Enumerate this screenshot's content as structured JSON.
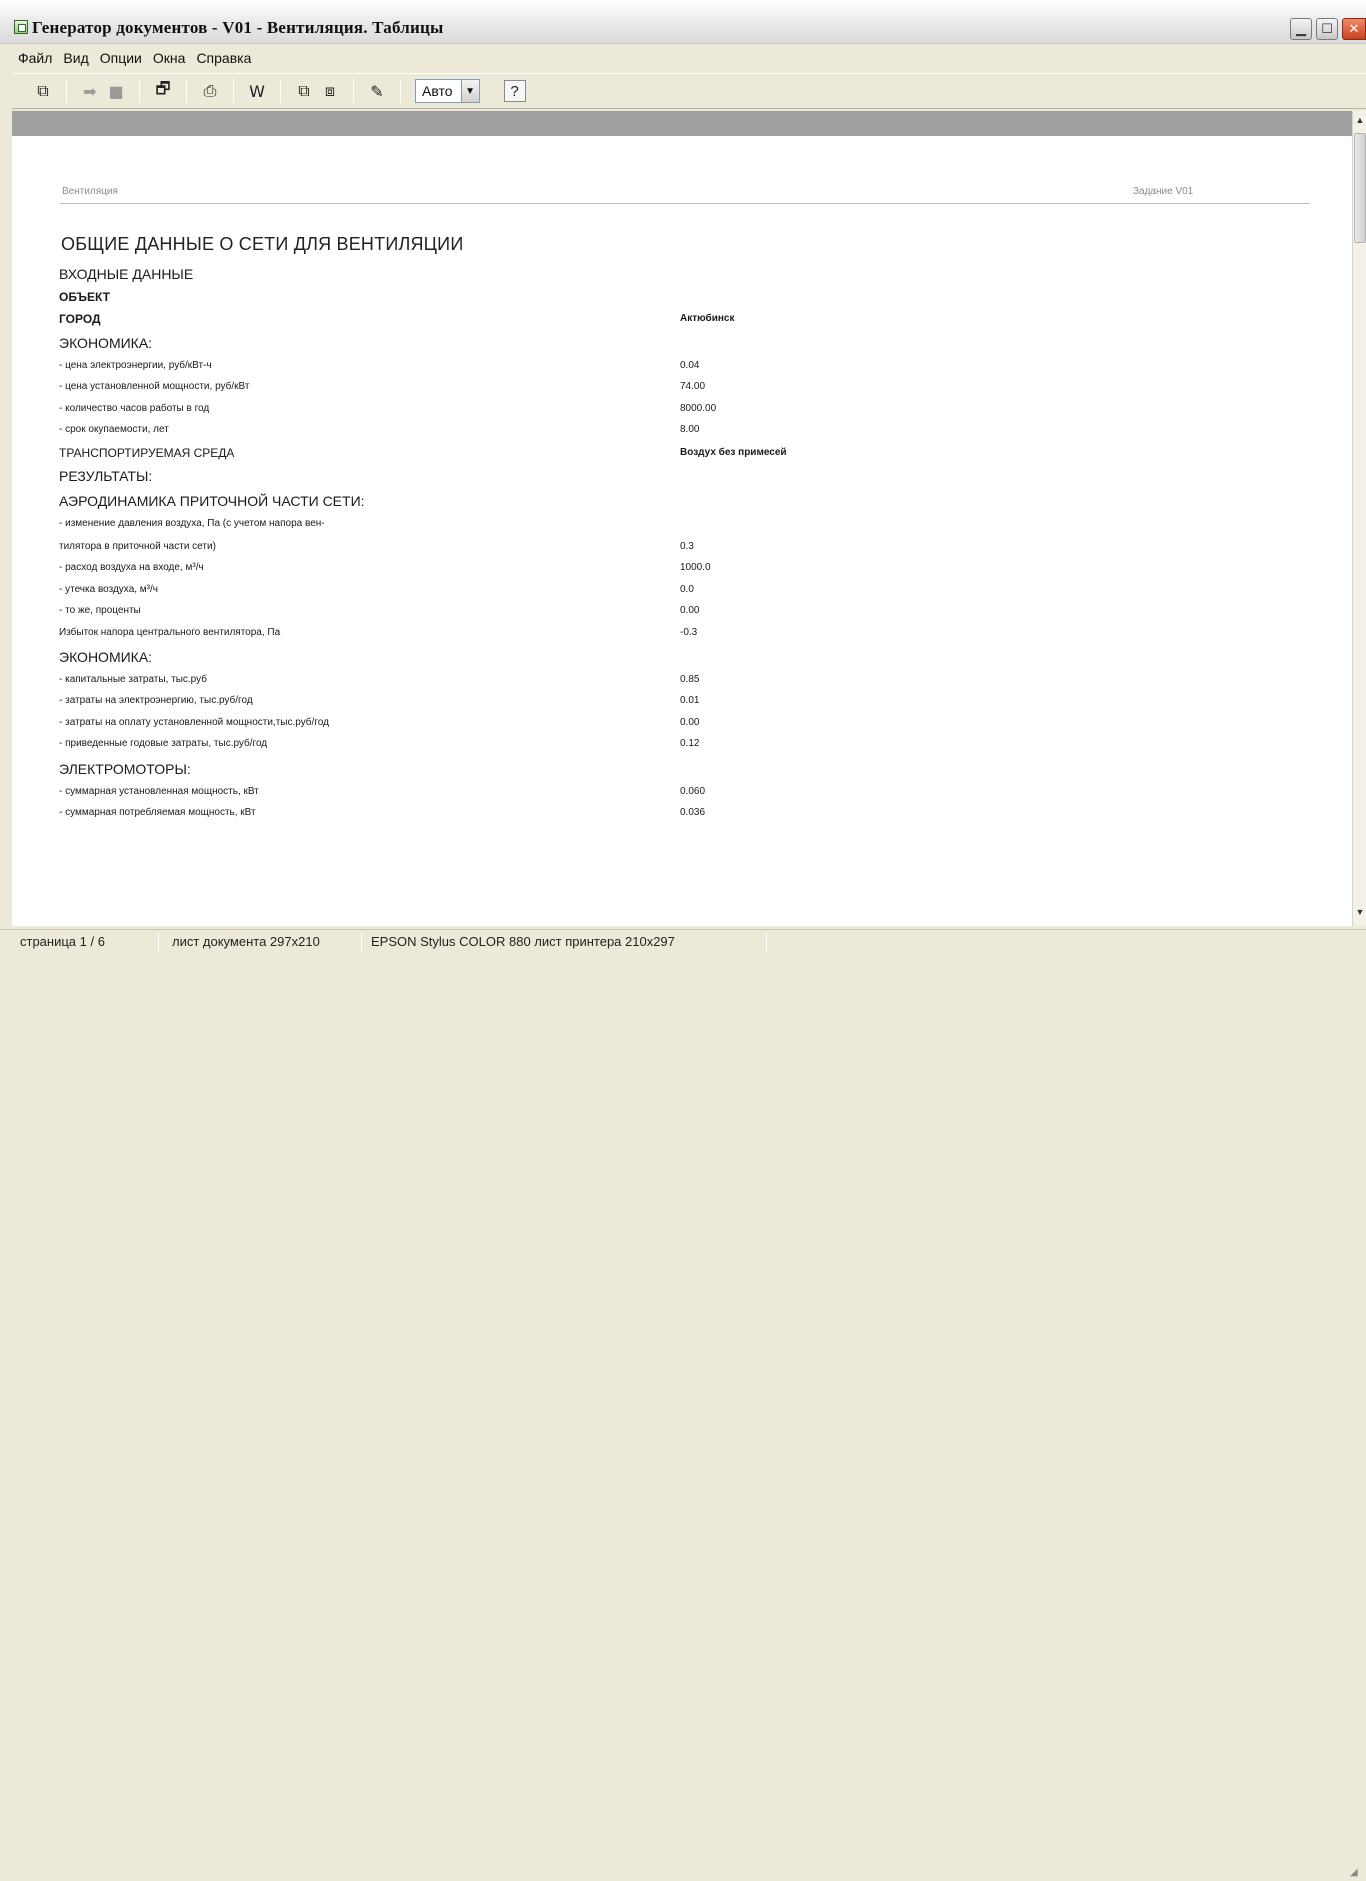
{
  "window": {
    "title": "Генератор документов - V01 - Вентиляция. Таблицы"
  },
  "menu": [
    "Файл",
    "Вид",
    "Опции",
    "Окна",
    "Справка"
  ],
  "toolbar": {
    "zoom_value": "Авто",
    "help_label": "?"
  },
  "page": {
    "header_left": "Вентиляция",
    "header_right": "Задание  V01",
    "title": "ОБЩИЕ ДАННЫЕ О СЕТИ ДЛЯ ВЕНТИЛЯЦИИ",
    "rows": [
      {
        "label": "ВХОДНЫЕ ДАННЫЕ",
        "value": ""
      },
      {
        "label": "ОБЪЕКТ",
        "value": ""
      },
      {
        "label": "ГОРОД",
        "value": "Актюбинск"
      },
      {
        "label": "ЭКОНОМИКА:",
        "value": ""
      },
      {
        "label": "- цена электроэнергии, руб/кВт-ч",
        "value": "0.04"
      },
      {
        "label": "- цена установленной мощности, руб/кВт",
        "value": "74.00"
      },
      {
        "label": "- количество часов работы в год",
        "value": "8000.00"
      },
      {
        "label": "- срок окупаемости, лет",
        "value": "8.00"
      },
      {
        "label": "ТРАНСПОРТИРУЕМАЯ СРЕДА",
        "value": "Воздух без примесей"
      },
      {
        "label": "РЕЗУЛЬТАТЫ:",
        "value": ""
      },
      {
        "label": "АЭРОДИНАМИКА ПРИТОЧНОЙ ЧАСТИ СЕТИ:",
        "value": ""
      },
      {
        "label": "- изменение давления воздуха, Па (с учетом напора вен-",
        "value": ""
      },
      {
        "label": "тилятора в приточной части сети)",
        "value": "0.3"
      },
      {
        "label": "- расход воздуха на входе, м³/ч",
        "value": "1000.0"
      },
      {
        "label": "- утечка воздуха, м³/ч",
        "value": "0.0"
      },
      {
        "label": "- то же, проценты",
        "value": "0.00"
      },
      {
        "label": "Избыток напора центрального вентилятора, Па",
        "value": "-0.3"
      },
      {
        "label": "ЭКОНОМИКА:",
        "value": ""
      },
      {
        "label": "- капитальные затраты, тыс.руб",
        "value": "0.85"
      },
      {
        "label": "- затраты на электроэнергию, тыс.руб/год",
        "value": "0.01"
      },
      {
        "label": "- затраты на оплату установленной мощности,тыс.руб/год",
        "value": "0.00"
      },
      {
        "label": "- приведенные годовые затраты, тыс.руб/год",
        "value": "0.12"
      },
      {
        "label": "ЭЛЕКТРОМОТОРЫ:",
        "value": ""
      },
      {
        "label": "- суммарная установленная мощность, кВт",
        "value": "0.060"
      },
      {
        "label": "- суммарная потребляемая мощность, кВт",
        "value": "0.036"
      }
    ]
  },
  "status": {
    "page": "страница 1 / 6",
    "doc_sheet": "лист документа 297x210",
    "printer": "EPSON Stylus COLOR 880  лист принтера 210x297"
  }
}
